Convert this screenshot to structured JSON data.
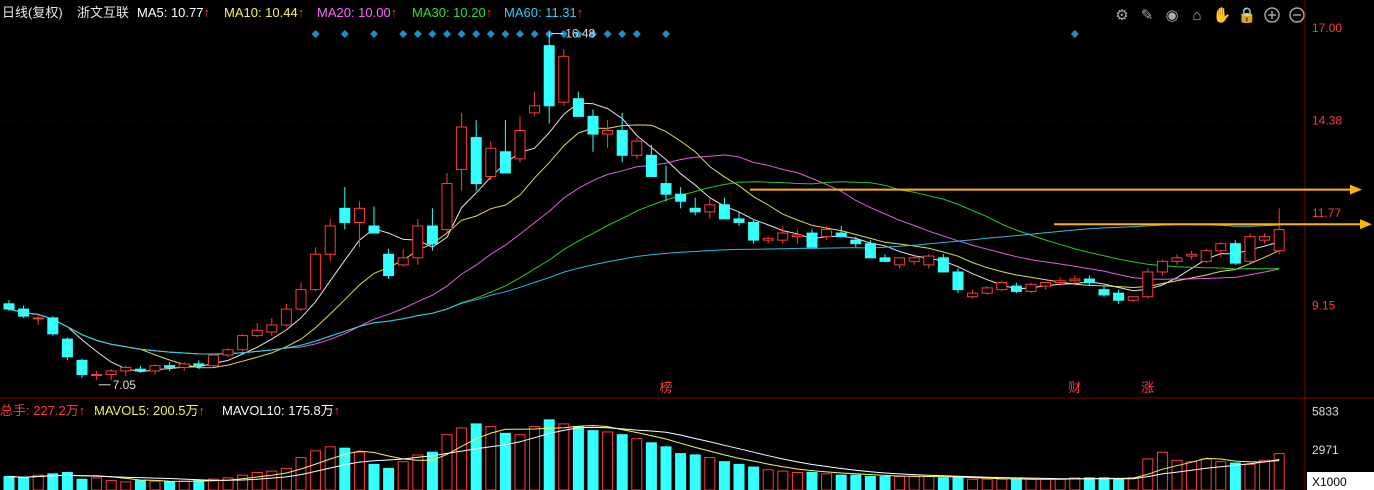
{
  "header": {
    "period": "日线(复权)",
    "stock_name": "浙文互联",
    "ma": [
      {
        "label": "MA5: 10.77",
        "color": "#ffffff"
      },
      {
        "label": "MA10: 10.44",
        "color": "#f5f55a"
      },
      {
        "label": "MA20: 10.00",
        "color": "#ff66ff"
      },
      {
        "label": "MA30: 10.20",
        "color": "#33dd33"
      },
      {
        "label": "MA60: 11.31",
        "color": "#33ccff"
      }
    ],
    "arrow": "↑",
    "toolbar_icons": [
      "gear-icon",
      "brush-icon",
      "eye-icon",
      "basket-icon",
      "hand-icon",
      "lock-icon",
      "zoom-in-icon",
      "zoom-out-icon"
    ]
  },
  "colors": {
    "up": "#ff3b3b",
    "down": "#33ffff",
    "grid": "#550000",
    "axis_text": "#ff3b3b",
    "marker": "#1e90c8",
    "trend": "#ffb400"
  },
  "chart_data": {
    "type": "candlestick",
    "yticks": [
      "17.00",
      "14.38",
      "11.77",
      "9.15"
    ],
    "ylim": [
      6.62,
      17.0
    ],
    "annotations": [
      {
        "text": "16.48",
        "kind": "high"
      },
      {
        "text": "7.05",
        "kind": "low"
      }
    ],
    "event_labels": [
      "榜",
      "财",
      "涨"
    ],
    "candles": [
      [
        9.2,
        9.3,
        9.0,
        9.05
      ],
      [
        9.05,
        9.15,
        8.8,
        8.85
      ],
      [
        8.8,
        8.9,
        8.6,
        8.8
      ],
      [
        8.8,
        8.85,
        8.3,
        8.35
      ],
      [
        8.2,
        8.25,
        7.6,
        7.7
      ],
      [
        7.6,
        7.65,
        7.1,
        7.2
      ],
      [
        7.2,
        7.3,
        7.05,
        7.2
      ],
      [
        7.2,
        7.35,
        7.05,
        7.3
      ],
      [
        7.3,
        7.45,
        7.15,
        7.4
      ],
      [
        7.35,
        7.45,
        7.25,
        7.3
      ],
      [
        7.3,
        7.5,
        7.2,
        7.45
      ],
      [
        7.45,
        7.55,
        7.3,
        7.4
      ],
      [
        7.4,
        7.55,
        7.3,
        7.5
      ],
      [
        7.5,
        7.6,
        7.35,
        7.45
      ],
      [
        7.45,
        7.8,
        7.4,
        7.75
      ],
      [
        7.75,
        7.95,
        7.7,
        7.9
      ],
      [
        7.9,
        8.35,
        7.85,
        8.3
      ],
      [
        8.3,
        8.65,
        8.25,
        8.45
      ],
      [
        8.4,
        8.8,
        8.3,
        8.6
      ],
      [
        8.6,
        9.2,
        8.55,
        9.05
      ],
      [
        9.05,
        9.8,
        9.0,
        9.6
      ],
      [
        9.6,
        10.8,
        9.55,
        10.6
      ],
      [
        10.6,
        11.6,
        10.4,
        11.4
      ],
      [
        11.9,
        12.5,
        11.3,
        11.5
      ],
      [
        11.5,
        12.1,
        10.8,
        11.9
      ],
      [
        11.4,
        11.95,
        11.3,
        11.2
      ],
      [
        10.6,
        10.75,
        9.9,
        10.0
      ],
      [
        10.3,
        10.75,
        10.25,
        10.5
      ],
      [
        10.5,
        11.6,
        10.3,
        11.4
      ],
      [
        11.4,
        11.9,
        10.7,
        10.9
      ],
      [
        11.3,
        12.9,
        11.2,
        12.6
      ],
      [
        13.0,
        14.6,
        12.4,
        14.2
      ],
      [
        13.9,
        14.4,
        12.4,
        12.6
      ],
      [
        12.8,
        13.8,
        12.7,
        13.6
      ],
      [
        13.5,
        14.4,
        12.9,
        12.9
      ],
      [
        13.3,
        14.5,
        13.2,
        14.1
      ],
      [
        14.6,
        15.2,
        14.5,
        14.8
      ],
      [
        16.5,
        16.9,
        14.3,
        14.8
      ],
      [
        14.9,
        16.4,
        14.8,
        16.2
      ],
      [
        15.0,
        15.2,
        14.5,
        14.5
      ],
      [
        14.5,
        14.7,
        13.5,
        14.0
      ],
      [
        14.0,
        14.4,
        13.6,
        14.1
      ],
      [
        14.1,
        14.6,
        13.2,
        13.4
      ],
      [
        13.4,
        13.9,
        13.3,
        13.8
      ],
      [
        13.4,
        13.7,
        12.9,
        12.8
      ],
      [
        12.6,
        13.1,
        12.1,
        12.3
      ],
      [
        12.3,
        12.5,
        11.9,
        12.1
      ],
      [
        11.9,
        12.2,
        11.7,
        11.8
      ],
      [
        11.8,
        12.2,
        11.6,
        12.0
      ],
      [
        12.0,
        12.2,
        11.8,
        11.6
      ],
      [
        11.6,
        11.8,
        11.4,
        11.5
      ],
      [
        11.5,
        11.6,
        10.9,
        11.0
      ],
      [
        11.0,
        11.1,
        10.9,
        11.05
      ],
      [
        11.0,
        11.4,
        10.9,
        11.2
      ],
      [
        11.1,
        11.3,
        10.9,
        11.15
      ],
      [
        11.2,
        11.3,
        10.8,
        10.8
      ],
      [
        11.1,
        11.4,
        11.0,
        11.3
      ],
      [
        11.2,
        11.4,
        11.1,
        11.1
      ],
      [
        11.0,
        11.1,
        10.8,
        10.9
      ],
      [
        10.9,
        11.0,
        10.6,
        10.5
      ],
      [
        10.5,
        10.6,
        10.4,
        10.4
      ],
      [
        10.3,
        10.5,
        10.2,
        10.5
      ],
      [
        10.4,
        10.6,
        10.3,
        10.5
      ],
      [
        10.3,
        10.6,
        10.2,
        10.55
      ],
      [
        10.5,
        10.6,
        10.1,
        10.1
      ],
      [
        10.1,
        10.2,
        9.5,
        9.6
      ],
      [
        9.4,
        9.6,
        9.35,
        9.5
      ],
      [
        9.5,
        9.7,
        9.45,
        9.65
      ],
      [
        9.6,
        9.85,
        9.55,
        9.8
      ],
      [
        9.7,
        9.8,
        9.5,
        9.55
      ],
      [
        9.55,
        9.8,
        9.5,
        9.75
      ],
      [
        9.7,
        9.8,
        9.6,
        9.8
      ],
      [
        9.8,
        9.95,
        9.7,
        9.85
      ],
      [
        9.85,
        10.0,
        9.75,
        9.9
      ],
      [
        9.9,
        10.0,
        9.7,
        9.8
      ],
      [
        9.6,
        9.7,
        9.4,
        9.45
      ],
      [
        9.5,
        9.6,
        9.2,
        9.3
      ],
      [
        9.3,
        9.4,
        9.25,
        9.4
      ],
      [
        9.4,
        10.2,
        9.35,
        10.1
      ],
      [
        10.1,
        10.45,
        10.0,
        10.4
      ],
      [
        10.4,
        10.6,
        10.3,
        10.5
      ],
      [
        10.55,
        10.7,
        10.45,
        10.6
      ],
      [
        10.4,
        10.75,
        10.35,
        10.7
      ],
      [
        10.7,
        10.95,
        10.5,
        10.9
      ],
      [
        10.9,
        11.0,
        10.3,
        10.35
      ],
      [
        10.4,
        11.2,
        10.35,
        11.1
      ],
      [
        11.0,
        11.2,
        10.9,
        11.1
      ],
      [
        10.7,
        11.9,
        10.6,
        11.3
      ]
    ],
    "vol_yticks": [
      "5833",
      "2971"
    ],
    "vol_unit": "X1000",
    "volume_legend": [
      {
        "label": "总手: 227.2万",
        "color": "#ff3b3b"
      },
      {
        "label": "MAVOL5: 200.5万",
        "color": "#f5f55a"
      },
      {
        "label": "MAVOL10: 175.8万",
        "color": "#ffffff"
      }
    ],
    "volume_max": 6300,
    "volumes": [
      1000,
      900,
      1100,
      1200,
      1300,
      800,
      900,
      700,
      600,
      700,
      650,
      600,
      650,
      700,
      800,
      900,
      1100,
      1300,
      1400,
      1600,
      2400,
      2900,
      3200,
      3100,
      2800,
      1900,
      1600,
      2100,
      2600,
      2800,
      4100,
      4600,
      4900,
      4700,
      4200,
      4100,
      4700,
      5200,
      4900,
      4700,
      4400,
      4300,
      4100,
      3800,
      3500,
      3200,
      2700,
      2600,
      2400,
      2100,
      1900,
      1700,
      1500,
      1400,
      1300,
      1300,
      1200,
      1100,
      1100,
      1000,
      1000,
      1000,
      1000,
      1000,
      900,
      900,
      800,
      800,
      800,
      800,
      800,
      800,
      800,
      900,
      900,
      900,
      800,
      900,
      2300,
      2800,
      2200,
      2100,
      2300,
      2100,
      2000,
      1900,
      2200,
      2700
    ]
  }
}
